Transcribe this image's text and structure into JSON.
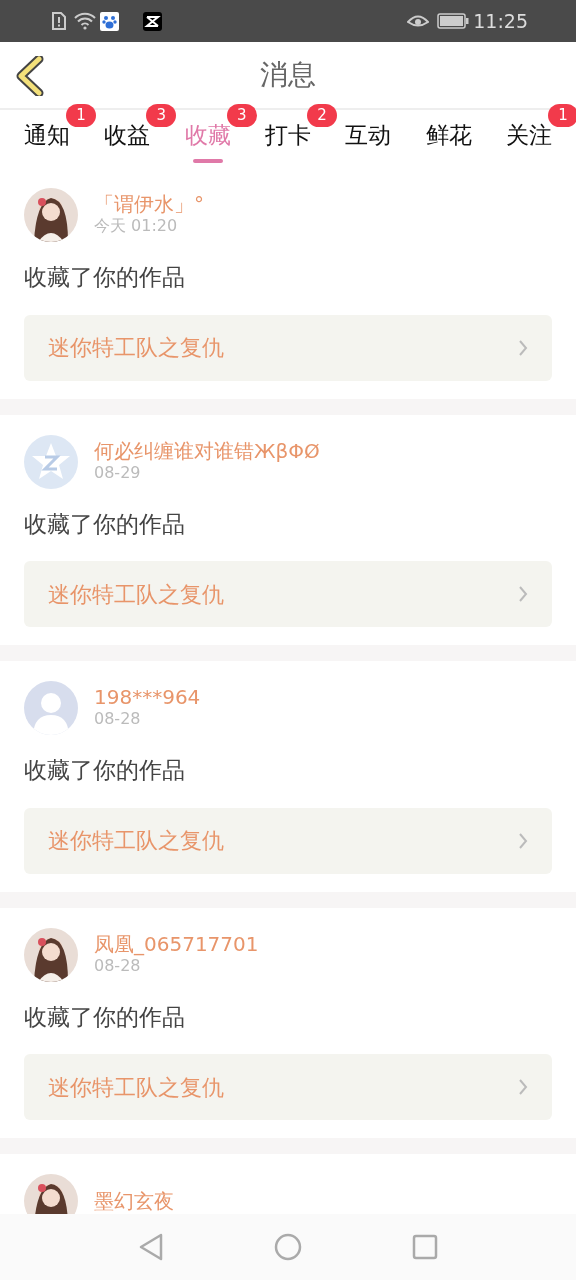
{
  "status_bar": {
    "time": "11:25"
  },
  "header": {
    "title": "消息"
  },
  "tabs": [
    {
      "label": "通知",
      "selected": false,
      "badge": "1"
    },
    {
      "label": "收益",
      "selected": false,
      "badge": "3"
    },
    {
      "label": "收藏",
      "selected": true,
      "badge": "3"
    },
    {
      "label": "打卡",
      "selected": false,
      "badge": "2"
    },
    {
      "label": "互动",
      "selected": false
    },
    {
      "label": "鲜花",
      "selected": false
    },
    {
      "label": "关注",
      "selected": false,
      "badge": "1"
    }
  ],
  "messages": [
    {
      "name": "「谓伊水」°",
      "time": "今天 01:20",
      "action": "收藏了你的作品",
      "work": "迷你特工队之复仇"
    },
    {
      "avatar": {
        "kind": "default-logo"
      },
      "name": "何必纠缠谁对谁错ЖβΦØ",
      "time": "08-29",
      "action": "收藏了你的作品",
      "work": "迷你特工队之复仇"
    },
    {
      "avatar": {
        "kind": "default-person"
      },
      "name": "198***964",
      "time": "08-28",
      "action": "收藏了你的作品",
      "work": "迷你特工队之复仇"
    },
    {
      "name": "凤凰_065717701",
      "time": "08-28",
      "action": "收藏了你的作品",
      "work": "迷你特工队之复仇"
    },
    {
      "name": "墨幻玄夜"
    }
  ]
}
